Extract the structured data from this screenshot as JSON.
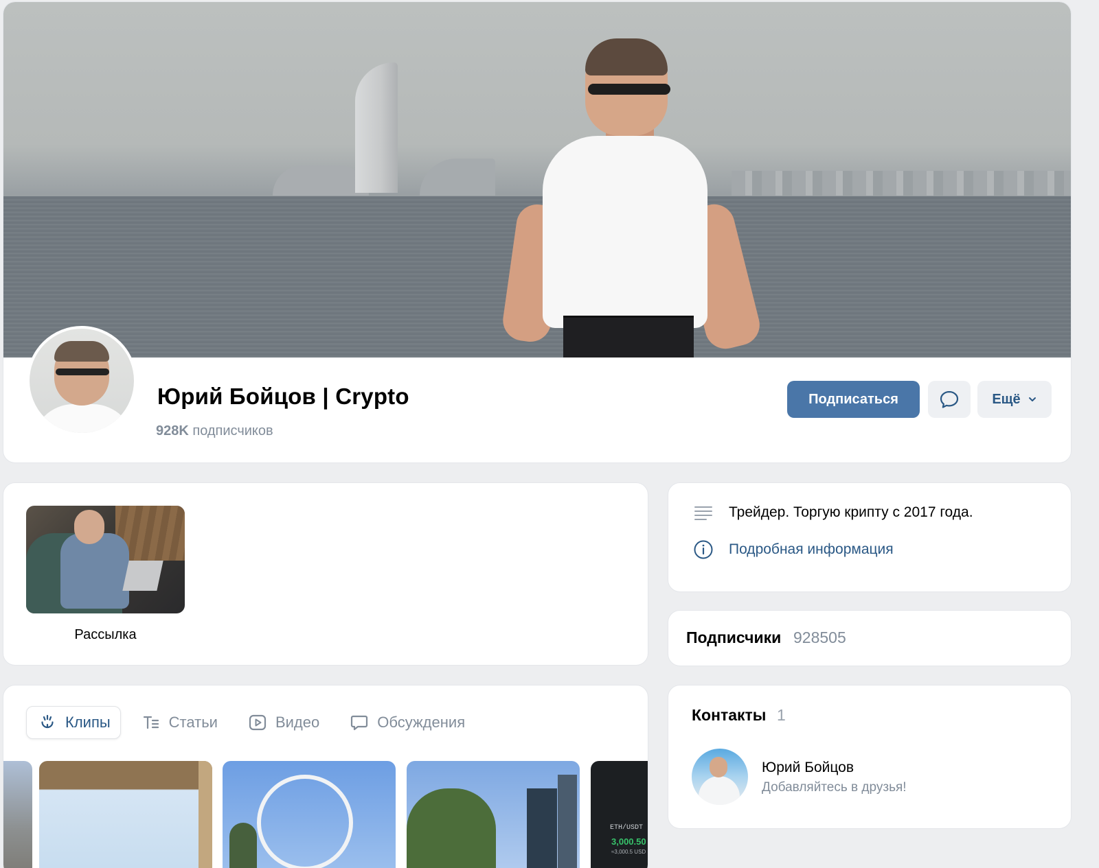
{
  "profile": {
    "name": "Юрий Бойцов | Crypto",
    "subscribers_count": "928K",
    "subscribers_label": "подписчиков",
    "subscribe_label": "Подписаться",
    "more_label": "Ещё"
  },
  "mailing": {
    "label": "Рассылка"
  },
  "tabs": [
    {
      "label": "Клипы",
      "icon": "clips-icon",
      "active": true
    },
    {
      "label": "Статьи",
      "icon": "articles-icon",
      "active": false
    },
    {
      "label": "Видео",
      "icon": "video-icon",
      "active": false
    },
    {
      "label": "Обсуждения",
      "icon": "discussions-icon",
      "active": false
    }
  ],
  "clips": {
    "ticker": "ETH/USDT",
    "price": "3,000.50",
    "price_sub": "≈3,000.5 USD"
  },
  "about": {
    "description": "Трейдер. Торгую крипту с 2017 года.",
    "details_link": "Подробная информация"
  },
  "followers": {
    "title": "Подписчики",
    "count": "928505"
  },
  "contacts": {
    "title": "Контакты",
    "count": "1",
    "items": [
      {
        "name": "Юрий Бойцов",
        "status": "Добавляйтесь в друзья!"
      }
    ]
  },
  "colors": {
    "accent": "#4a76a8",
    "link": "#2a5885",
    "muted": "#818c99",
    "background": "#edeef0"
  }
}
